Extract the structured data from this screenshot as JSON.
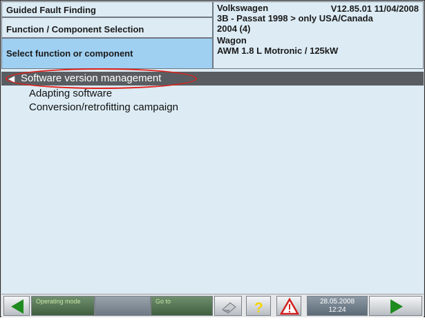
{
  "header": {
    "guided": "Guided Fault Finding",
    "function_selection": "Function / Component Selection",
    "select_prompt": "Select function or component"
  },
  "vehicle": {
    "make": "Volkswagen",
    "version": "V12.85.01 11/04/2008",
    "model": "3B - Passat 1998 > only USA/Canada",
    "year": "2004 (4)",
    "body": "Wagon",
    "engine": "AWM 1.8 L Motronic / 125kW"
  },
  "tree": {
    "selected": "Software version management",
    "items": [
      "Adapting software",
      "Conversion/retrofitting campaign"
    ]
  },
  "toolbar": {
    "operating_mode": "Operating mode",
    "go_to": "Go to",
    "date": "28.05.2008",
    "time": "12:24"
  },
  "colors": {
    "panel": "#dcebf4",
    "highlight": "#9fd0f2",
    "selected_bar": "#595d61",
    "annotation": "#e0201b",
    "arrow_green": "#1f8a1f"
  }
}
